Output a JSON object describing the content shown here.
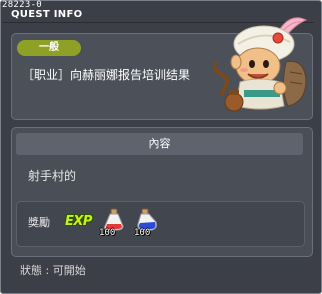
{
  "window": {
    "quest_id": "28223-0",
    "title": "QUEST INFO"
  },
  "quest": {
    "category": "一般",
    "name": "［职业］向赫丽娜报告培训结果"
  },
  "content": {
    "header": "內容",
    "text": "射手村的"
  },
  "reward": {
    "label": "獎勵",
    "exp_label": "EXP",
    "items": [
      {
        "icon": "red-potion-icon",
        "qty": "100"
      },
      {
        "icon": "blue-potion-icon",
        "qty": "100"
      }
    ]
  },
  "status": {
    "text": "狀態 : 可開始"
  },
  "colors": {
    "window_bg": "#3c3f47",
    "badge": "#8ea126",
    "exp": "#c8f01e"
  }
}
